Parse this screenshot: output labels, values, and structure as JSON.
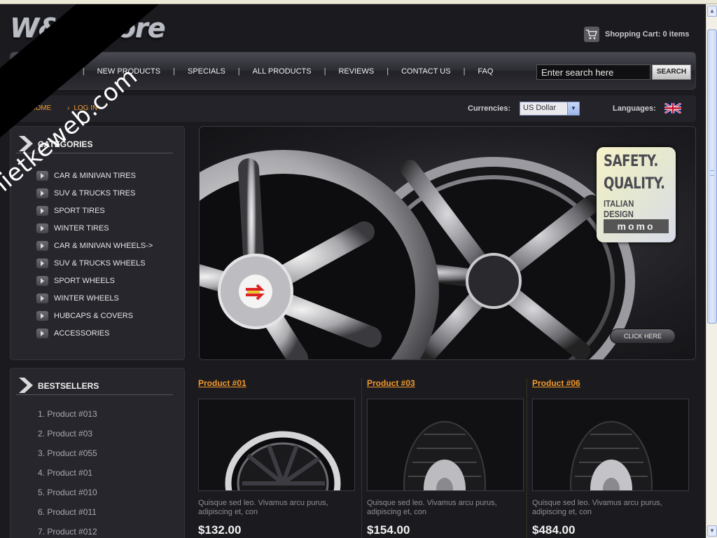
{
  "logo": {
    "text": "W&T Store"
  },
  "cart": {
    "label": "Shopping Cart: 0 items"
  },
  "nav": {
    "items": [
      "HOME PAGE",
      "NEW PRODUCTS",
      "SPECIALS",
      "ALL PRODUCTS",
      "REVIEWS",
      "CONTACT US",
      "FAQ"
    ],
    "separator": "|"
  },
  "search": {
    "value": "Enter search here",
    "button": "SEARCH"
  },
  "breadcrumb": {
    "home": "HOME",
    "login": "LOG IN",
    "arrow": "›"
  },
  "currencies": {
    "label": "Currencies:",
    "selected": "US Dollar"
  },
  "languages": {
    "label": "Languages:"
  },
  "categories": {
    "title": "CATEGORIES",
    "items": [
      "CAR & MINIVAN TIRES",
      "SUV & TRUCKS TIRES",
      "SPORT TIRES",
      "WINTER TIRES",
      "CAR & MINIVAN WHEELS->",
      "SUV & TRUCKS WHEELS",
      "SPORT WHEELS",
      "WINTER WHEELS",
      "HUBCAPS & COVERS",
      "ACCESSORIES"
    ]
  },
  "bestsellers": {
    "title": "BESTSELLERS",
    "items": [
      "1. Product #013",
      "2. Product #03",
      "3. Product #055",
      "4. Product #01",
      "5. Product #010",
      "6. Product #011",
      "7. Product #012"
    ]
  },
  "banner": {
    "badge_line1": "SAFETY.",
    "badge_line2": "QUALITY.",
    "badge_line3": "ITALIAN DESIGN",
    "badge_brand": "momo",
    "button": "CLICK HERE"
  },
  "products": [
    {
      "title": "Product #01",
      "desc": "Quisque sed leo. Vivamus arcu purus, adipiscing et, con",
      "price": "$132.00",
      "image": "wheel"
    },
    {
      "title": "Product #03",
      "desc": "Quisque sed leo. Vivamus arcu purus, adipiscing et, con",
      "price": "$154.00",
      "image": "tire"
    },
    {
      "title": "Product #06",
      "desc": "Quisque sed leo. Vivamus arcu purus, adipiscing et, con",
      "price": "$484.00",
      "image": "tire"
    }
  ],
  "watermark": {
    "text": "thietkeweb.com"
  },
  "colors": {
    "accent": "#f39a2a",
    "background": "#1a1a1f"
  }
}
